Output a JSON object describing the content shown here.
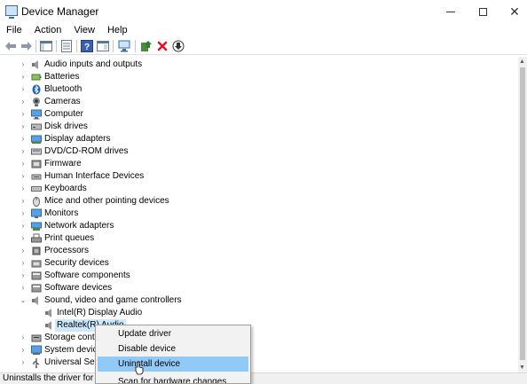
{
  "window": {
    "title": "Device Manager",
    "min_glyph": "—",
    "max_glyph": "☐",
    "close_glyph": "✕"
  },
  "menubar": {
    "items": [
      {
        "label": "File"
      },
      {
        "label": "Action"
      },
      {
        "label": "View"
      },
      {
        "label": "Help"
      }
    ]
  },
  "toolbar": {
    "buttons": [
      {
        "icon": "back-arrow-icon"
      },
      {
        "icon": "forward-arrow-icon"
      },
      {
        "icon": "show-hide-console-tree-icon"
      },
      {
        "icon": "properties-icon"
      },
      {
        "icon": "help-icon"
      },
      {
        "icon": "view-icon"
      },
      {
        "icon": "scan-hardware-icon"
      },
      {
        "icon": "update-driver-icon"
      },
      {
        "icon": "uninstall-device-icon"
      },
      {
        "icon": "download-icon"
      }
    ]
  },
  "tree": {
    "categories": [
      {
        "label": "Audio inputs and outputs",
        "icon": "speaker-icon",
        "expander": "›"
      },
      {
        "label": "Batteries",
        "icon": "battery-icon",
        "expander": "›"
      },
      {
        "label": "Bluetooth",
        "icon": "bluetooth-icon",
        "expander": "›"
      },
      {
        "label": "Cameras",
        "icon": "camera-icon",
        "expander": "›"
      },
      {
        "label": "Computer",
        "icon": "computer-icon",
        "expander": "›"
      },
      {
        "label": "Disk drives",
        "icon": "disk-drive-icon",
        "expander": "›"
      },
      {
        "label": "Display adapters",
        "icon": "display-adapter-icon",
        "expander": "›"
      },
      {
        "label": "DVD/CD-ROM drives",
        "icon": "dvd-drive-icon",
        "expander": "›"
      },
      {
        "label": "Firmware",
        "icon": "firmware-icon",
        "expander": "›"
      },
      {
        "label": "Human Interface Devices",
        "icon": "hid-icon",
        "expander": "›"
      },
      {
        "label": "Keyboards",
        "icon": "keyboard-icon",
        "expander": "›"
      },
      {
        "label": "Mice and other pointing devices",
        "icon": "mouse-icon",
        "expander": "›"
      },
      {
        "label": "Monitors",
        "icon": "monitor-icon",
        "expander": "›"
      },
      {
        "label": "Network adapters",
        "icon": "network-adapter-icon",
        "expander": "›"
      },
      {
        "label": "Print queues",
        "icon": "printer-icon",
        "expander": "›"
      },
      {
        "label": "Processors",
        "icon": "processor-icon",
        "expander": "›"
      },
      {
        "label": "Security devices",
        "icon": "security-device-icon",
        "expander": "›"
      },
      {
        "label": "Software components",
        "icon": "software-component-icon",
        "expander": "›"
      },
      {
        "label": "Software devices",
        "icon": "software-device-icon",
        "expander": "›"
      },
      {
        "label": "Sound, video and game controllers",
        "icon": "speaker-icon",
        "expander": "⌄"
      }
    ],
    "sound_children": [
      {
        "label": "Intel(R) Display Audio",
        "icon": "speaker-icon"
      },
      {
        "label": "Realtek(R) Audio",
        "icon": "speaker-icon",
        "selected": true
      }
    ],
    "after": [
      {
        "label": "Storage contro",
        "icon": "storage-controller-icon",
        "expander": "›"
      },
      {
        "label": "System device",
        "icon": "system-device-icon",
        "expander": "›"
      },
      {
        "label": "Universal Seria",
        "icon": "usb-icon",
        "expander": "›"
      }
    ]
  },
  "context_menu": {
    "items": [
      {
        "label": "Update driver"
      },
      {
        "label": "Disable device"
      },
      {
        "label": "Uninstall device",
        "highlighted": true
      },
      {
        "label": "Scan for hardware changes"
      }
    ]
  },
  "statusbar": {
    "text": "Uninstalls the driver for th"
  },
  "colors": {
    "selection": "#cce8ff",
    "menu_highlight": "#91c9f7",
    "uninstall_red": "#e81123"
  }
}
